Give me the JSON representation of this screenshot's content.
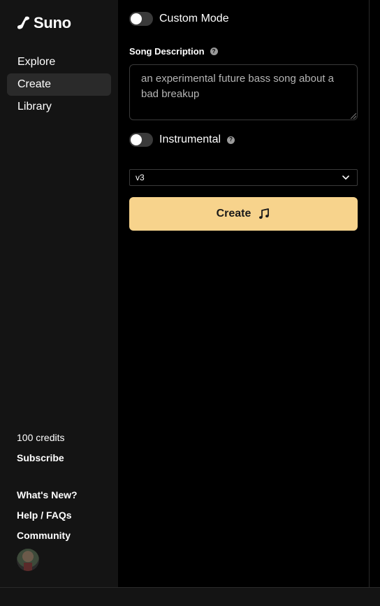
{
  "brand": {
    "name": "Suno",
    "icon": "suno-logo-icon"
  },
  "sidebar": {
    "nav": [
      {
        "label": "Explore",
        "active": false
      },
      {
        "label": "Create",
        "active": true
      },
      {
        "label": "Library",
        "active": false
      }
    ],
    "credits": "100 credits",
    "subscribe": "Subscribe",
    "links": [
      "What's New?",
      "Help / FAQs",
      "Community"
    ]
  },
  "form": {
    "custom_mode": {
      "label": "Custom Mode",
      "on": false
    },
    "song_description": {
      "label": "Song Description",
      "value": "an experimental future bass song about a bad breakup"
    },
    "instrumental": {
      "label": "Instrumental",
      "on": false
    },
    "model_select": {
      "value": "v3"
    },
    "create_button": {
      "label": "Create",
      "icon": "music-note-icon"
    }
  },
  "colors": {
    "accent": "#f7d38c",
    "sidebar_bg": "#141414",
    "main_bg": "#000000"
  }
}
